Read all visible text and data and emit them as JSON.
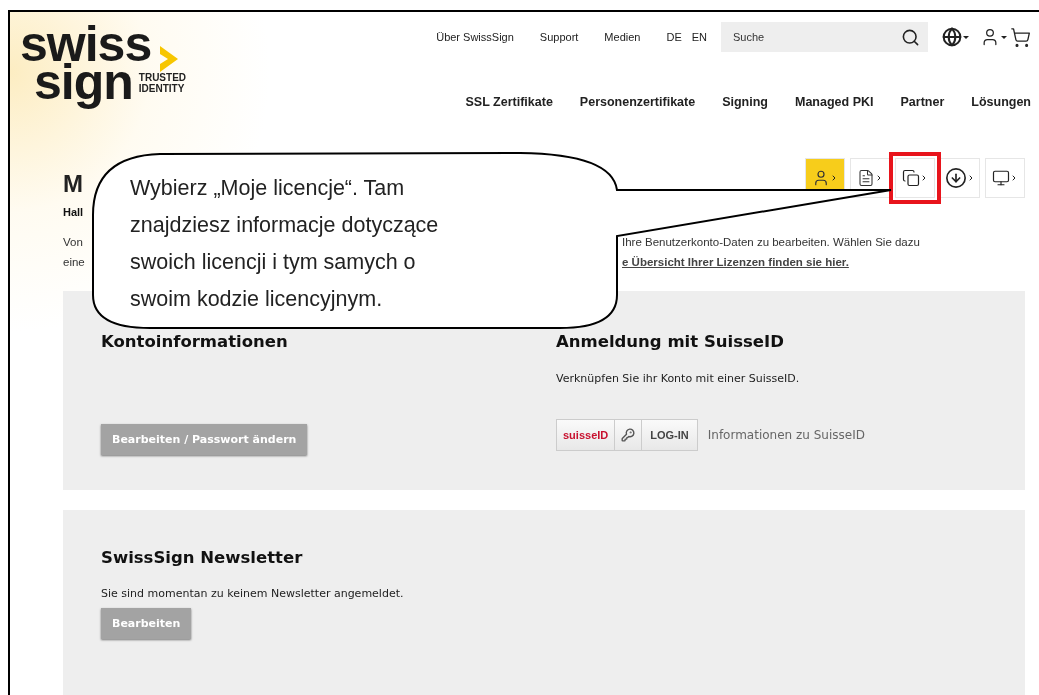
{
  "logo": {
    "line1": "swiss",
    "line2": "sign",
    "tagline": [
      "TRUSTED",
      "IDENTITY"
    ]
  },
  "top_nav": [
    "Über SwissSign",
    "Support",
    "Medien"
  ],
  "languages": [
    {
      "label": "DE",
      "selected": false
    },
    {
      "label": "EN",
      "selected": false
    }
  ],
  "search": {
    "placeholder": "Suche"
  },
  "main_nav": [
    "SSL Zertifikate",
    "Personenzertifikate",
    "Signing",
    "Managed PKI",
    "Partner",
    "Lösungen"
  ],
  "account_tabs": [
    {
      "kind": "user",
      "selected": true,
      "highlighted": false
    },
    {
      "kind": "document",
      "selected": false,
      "highlighted": false
    },
    {
      "kind": "copies",
      "selected": false,
      "highlighted": true
    },
    {
      "kind": "download",
      "selected": false,
      "highlighted": false
    },
    {
      "kind": "monitor",
      "selected": false,
      "highlighted": false
    }
  ],
  "heading": "M",
  "greeting": "Hall",
  "intro": [
    {
      "left": "Von",
      "right": "Ihre Benutzerkonto-Daten zu bearbeiten. Wählen Sie dazu",
      "link": false
    },
    {
      "left": "eine",
      "right": "e Übersicht Ihrer Lizenzen finden sie hier.",
      "link": true
    }
  ],
  "account_card": {
    "title": "Kontoinformationen",
    "button": "Bearbeiten / Passwort ändern",
    "suisseid": {
      "title": "Anmeldung mit SuisseID",
      "text": "Verknüpfen Sie ihr Konto mit einer SuisseID.",
      "logo": "suisseID",
      "login": "LOG-IN",
      "info_link": "Informationen zu SuisseID"
    }
  },
  "newsletter_card": {
    "title": "SwissSign Newsletter",
    "text": "Sie sind momentan zu keinem Newsletter angemeldet.",
    "button": "Bearbeiten"
  },
  "callout": {
    "lines": [
      "Wybierz „Moje licencje“. Tam",
      "znajdziesz informacje dotyczące",
      "swoich licencji i tym samych o",
      "swoim kodzie licencyjnym."
    ]
  }
}
